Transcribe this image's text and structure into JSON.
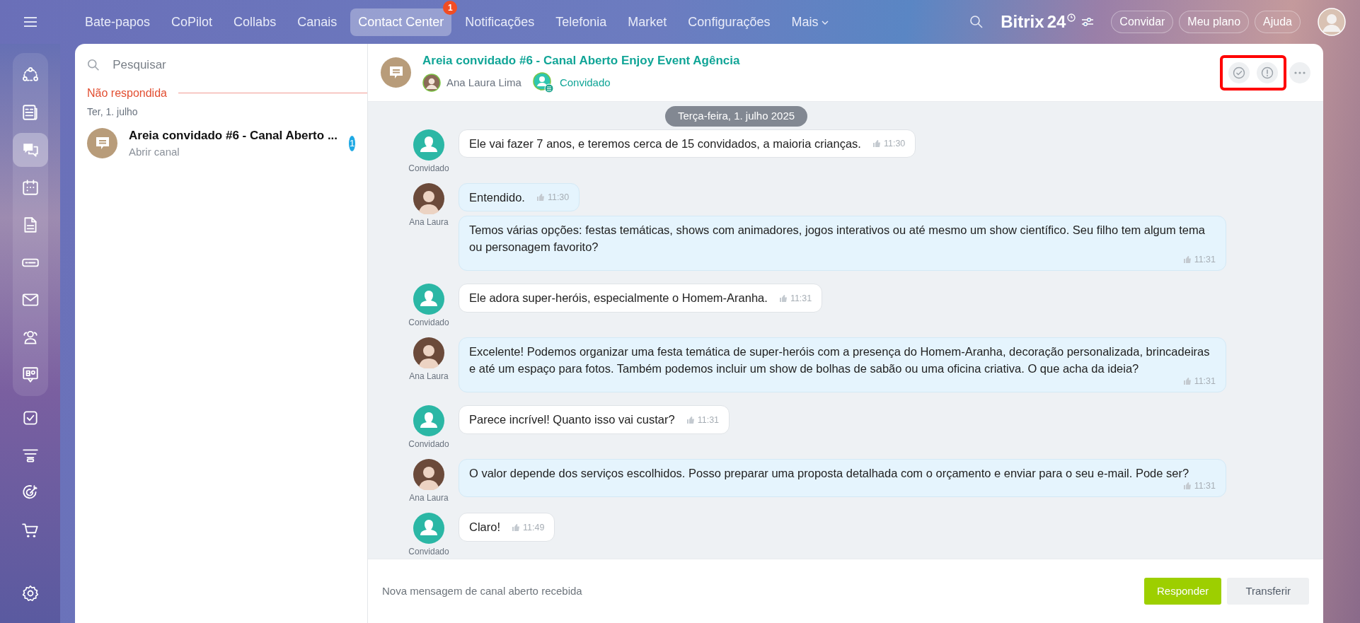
{
  "top_nav": {
    "tabs": [
      {
        "label": "Bate-papos",
        "selected": false
      },
      {
        "label": "CoPilot",
        "selected": false
      },
      {
        "label": "Collabs",
        "selected": false
      },
      {
        "label": "Canais",
        "selected": false
      },
      {
        "label": "Contact Center",
        "selected": true,
        "badge": "1"
      },
      {
        "label": "Notificações",
        "selected": false
      },
      {
        "label": "Telefonia",
        "selected": false
      },
      {
        "label": "Market",
        "selected": false
      },
      {
        "label": "Configurações",
        "selected": false
      },
      {
        "label": "Mais",
        "selected": false,
        "dropdown": true
      }
    ],
    "logo": {
      "name": "Bitrix",
      "number": "24"
    },
    "buttons": [
      "Convidar",
      "Meu plano",
      "Ajuda"
    ]
  },
  "rail": {
    "pinned_items": [
      {
        "selected": false
      },
      {
        "selected": false
      },
      {
        "selected": true
      },
      {
        "selected": false
      },
      {
        "selected": false
      },
      {
        "selected": false
      },
      {
        "selected": false
      },
      {
        "selected": false
      },
      {
        "selected": false
      }
    ],
    "items": [
      {
        "selected": false
      },
      {
        "selected": false
      },
      {
        "selected": false
      },
      {
        "selected": false
      }
    ]
  },
  "chat_list": {
    "search": {
      "placeholder": "Pesquisar"
    },
    "section": "Não respondida",
    "date": "Ter, 1. julho",
    "items": [
      {
        "title": "Areia convidado #6 - Canal Aberto ...",
        "subtitle": "Abrir canal",
        "unread": "1",
        "selected": false
      }
    ]
  },
  "chat": {
    "title": "Areia convidado #6 - Canal Aberto Enjoy Event Agência",
    "operator": "Ana Laura Lima",
    "guest": "Convidado",
    "actions_highlighted": true,
    "date_pill": "Terça-feira, 1. julho 2025",
    "groups": [
      {
        "kind": "guest",
        "author": "Convidado",
        "messages": [
          {
            "text": "Ele vai fazer 7 anos, e teremos cerca de 15 convidados, a maioria crianças.",
            "time": "11:30"
          }
        ]
      },
      {
        "kind": "agent",
        "author": "Ana Laura",
        "messages": [
          {
            "text": "Entendido.",
            "time": "11:30"
          },
          {
            "text": "Temos várias opções: festas temáticas, shows com animadores, jogos interativos ou até mesmo um show científico. Seu filho tem algum tema ou personagem favorito?",
            "time": "11:31"
          }
        ]
      },
      {
        "kind": "guest",
        "author": "Convidado",
        "messages": [
          {
            "text": "Ele adora super-heróis, especialmente o Homem-Aranha.",
            "time": "11:31"
          }
        ]
      },
      {
        "kind": "agent",
        "author": "Ana Laura",
        "messages": [
          {
            "text": "Excelente! Podemos organizar uma festa temática de super-heróis com a presença do Homem-Aranha, decoração personalizada, brincadeiras e até um espaço para fotos. Também podemos incluir um show de bolhas de sabão ou uma oficina criativa. O que acha da ideia?",
            "time": "11:31"
          }
        ]
      },
      {
        "kind": "guest",
        "author": "Convidado",
        "messages": [
          {
            "text": "Parece incrível! Quanto isso vai custar?",
            "time": "11:31"
          }
        ]
      },
      {
        "kind": "agent",
        "author": "Ana Laura",
        "messages": [
          {
            "text": "O valor depende dos serviços escolhidos. Posso preparar uma proposta detalhada com o orçamento e enviar para o seu e-mail. Pode ser?",
            "time": "11:31"
          }
        ]
      },
      {
        "kind": "guest",
        "author": "Convidado",
        "messages": [
          {
            "text": "Claro!",
            "time": "11:49"
          }
        ]
      }
    ],
    "footer": {
      "notice": "Nova mensagem de canal aberto recebida",
      "primary": "Responder",
      "secondary": "Transferir"
    }
  }
}
